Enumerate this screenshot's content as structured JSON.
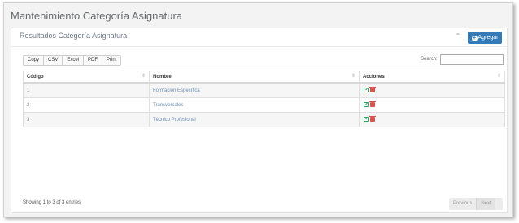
{
  "page": {
    "title": "Mantenimiento Categoría Asignatura"
  },
  "panel": {
    "title": "Resultados Categoría Asignatura",
    "collapse_icon": "chevron-up-icon",
    "add_label": "Agregar",
    "add_icon": "plus-circle-icon"
  },
  "toolbar": {
    "buttons": [
      "Copy",
      "CSV",
      "Excel",
      "PDF",
      "Print"
    ],
    "search_label": "Search:",
    "search_value": ""
  },
  "table": {
    "columns": [
      "Código",
      "Nombre",
      "Acciones"
    ],
    "rows": [
      {
        "codigo": "1",
        "nombre": "Formación Específica"
      },
      {
        "codigo": "2",
        "nombre": "Transversales"
      },
      {
        "codigo": "3",
        "nombre": "Técnico Profesional"
      }
    ],
    "action_icons": [
      "edit-icon",
      "trash-icon"
    ]
  },
  "footer": {
    "info": "Showing 1 to 3 of 3 entries",
    "previous": "Previous",
    "next": "Next"
  },
  "colors": {
    "accent": "#337ab7",
    "edit": "#2fa360",
    "delete": "#d9534f",
    "link_text": "#6a8bb0"
  }
}
